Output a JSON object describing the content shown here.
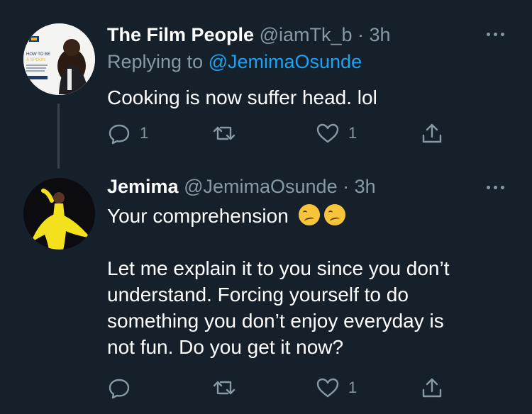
{
  "tweet1": {
    "name": "The Film People",
    "handle": "@iamTk_b",
    "time": "· 3h",
    "replying_prefix": "Replying to ",
    "replying_to": "@JemimaOsunde",
    "text": "Cooking is now suffer head. lol",
    "reply_count": "1",
    "like_count": "1",
    "avatar_caption_1": "HOW TO BE",
    "avatar_caption_2": "A SPOON"
  },
  "tweet2": {
    "name": "Jemima",
    "handle": "@JemimaOsunde",
    "time": "· 3h",
    "text_line1": "Your comprehension",
    "text_para2": [
      "Let me explain it to you since you don’t",
      "understand. Forcing yourself to do",
      "something you don’t enjoy everyday is",
      "not fun. Do you get it now?"
    ],
    "like_count": "1",
    "emoji": [
      "confused-face-emoji",
      "confused-face-emoji"
    ]
  },
  "colors": {
    "background": "#15202b",
    "muted": "#8899a6",
    "accent": "#1da1f2"
  }
}
